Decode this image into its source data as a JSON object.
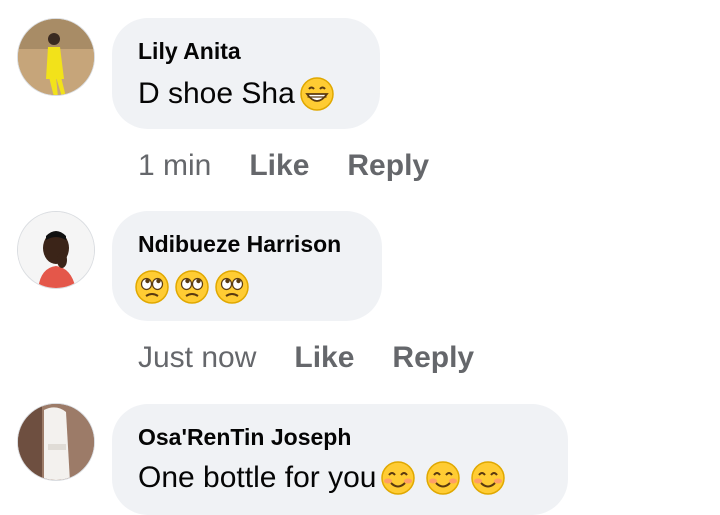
{
  "comments": [
    {
      "author": "Lily Anita",
      "text": "D shoe Sha",
      "emojis": [
        "grinning-face"
      ],
      "time": "1 min",
      "like_label": "Like",
      "reply_label": "Reply"
    },
    {
      "author": "Ndibueze Harrison",
      "text": "",
      "emojis": [
        "face-with-rolling-eyes",
        "face-with-rolling-eyes",
        "face-with-rolling-eyes"
      ],
      "time": "Just now",
      "like_label": "Like",
      "reply_label": "Reply"
    },
    {
      "author": "Osa'RenTin Joseph",
      "text": "One bottle for you",
      "emojis": [
        "smiling-face-with-smiling-eyes",
        "smiling-face-with-smiling-eyes",
        "smiling-face-with-smiling-eyes"
      ],
      "time": "",
      "like_label": "",
      "reply_label": ""
    }
  ],
  "colors": {
    "bubble": "#f0f2f5",
    "author": "#050505",
    "meta": "#65676b",
    "emoji_face": "#ffcc33"
  }
}
